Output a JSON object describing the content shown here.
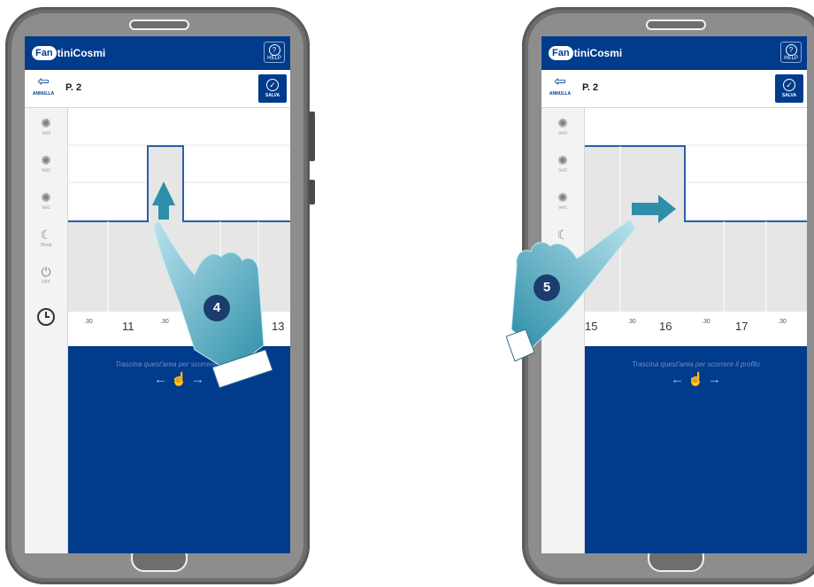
{
  "brand": {
    "logo_prefix": "Fan",
    "logo_rest": "tiniCosmi"
  },
  "header": {
    "cancel_label": "ANNULLA",
    "program_title": "P. 2",
    "save_label": "SALVA",
    "help_label": "HELP",
    "help_glyph": "?"
  },
  "modes": [
    {
      "label": "Vel3",
      "icon": "fan-speed-3-icon",
      "glyph": "✺"
    },
    {
      "label": "Vel2",
      "icon": "fan-speed-2-icon",
      "glyph": "✺"
    },
    {
      "label": "Vel1",
      "icon": "fan-speed-1-icon",
      "glyph": "✺"
    },
    {
      "label": "Sleep",
      "icon": "sleep-moon-icon",
      "glyph": "☾"
    },
    {
      "label": "OFF",
      "icon": "power-icon",
      "glyph": "⏻"
    }
  ],
  "drag_hint": "Trascina quest'area per scorrere il profilo",
  "drag_gesture": "← ☝ →",
  "left_phone": {
    "step_number": "4",
    "timeline": [
      ".30",
      "11",
      ".30",
      "13"
    ]
  },
  "right_phone": {
    "step_number": "5",
    "timeline": [
      "15",
      ".30",
      "16",
      ".30",
      "17",
      ".30"
    ]
  },
  "colors": {
    "brand_blue": "#003b8c",
    "chart_line": "#2b5fa8",
    "chart_fill": "#e6e6e6",
    "hand": "#3aa0b8"
  }
}
